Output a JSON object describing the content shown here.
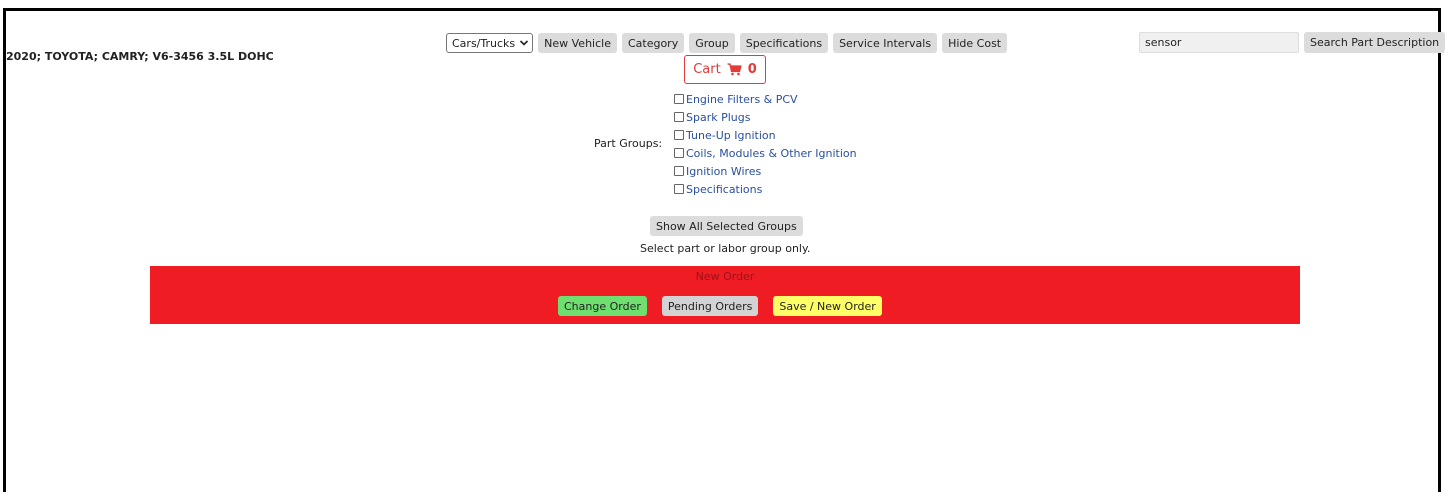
{
  "vehicle": {
    "title": "2020; TOYOTA; CAMRY; V6-3456 3.5L DOHC"
  },
  "toolbar": {
    "vehicle_type": "Cars/Trucks",
    "new_vehicle": "New Vehicle",
    "category": "Category",
    "group": "Group",
    "specifications": "Specifications",
    "service_intervals": "Service Intervals",
    "hide_cost": "Hide Cost"
  },
  "search": {
    "value": "sensor",
    "button": "Search Part Description"
  },
  "cart": {
    "label": "Cart",
    "count": "0",
    "color": "#e33b3b"
  },
  "part_groups": {
    "label": "Part Groups:",
    "items": [
      "Engine Filters & PCV",
      "Spark Plugs",
      "Tune-Up Ignition",
      "Coils, Modules & Other Ignition",
      "Ignition Wires",
      "Specifications"
    ],
    "link_color": "#2a4f9e"
  },
  "show_all": "Show All Selected Groups",
  "hint": "Select part or labor group only.",
  "order": {
    "title": "New Order",
    "bar_color": "#f01c24",
    "change_order": "Change Order",
    "pending_orders": "Pending Orders",
    "save_new_order": "Save / New Order"
  }
}
